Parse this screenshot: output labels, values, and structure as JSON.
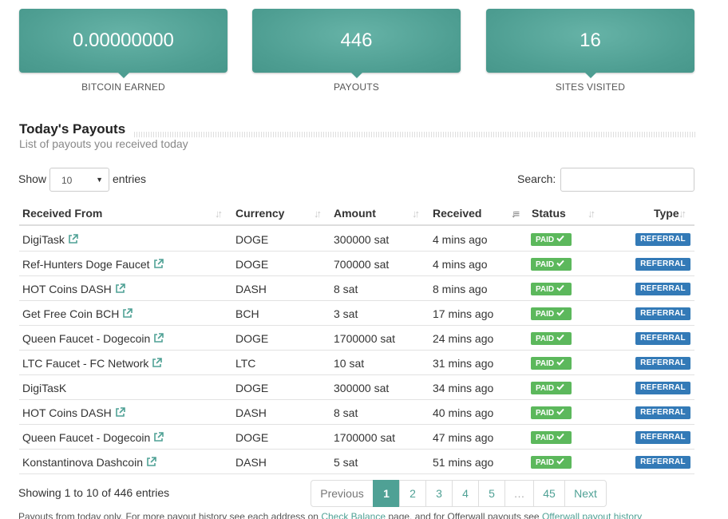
{
  "stats": [
    {
      "value": "0.00000000",
      "label": "BITCOIN EARNED"
    },
    {
      "value": "446",
      "label": "PAYOUTS"
    },
    {
      "value": "16",
      "label": "SITES VISITED"
    }
  ],
  "section": {
    "title": "Today's Payouts",
    "subtitle": "List of payouts you received today"
  },
  "controls": {
    "show_label": "Show",
    "entries_value": "10",
    "entries_label": "entries",
    "search_label": "Search:",
    "search_value": ""
  },
  "table": {
    "headers": [
      "Received From",
      "Currency",
      "Amount",
      "Received",
      "Status",
      "Type"
    ],
    "rows": [
      {
        "from": "DigiTask",
        "currency": "DOGE",
        "amount": "300000 sat",
        "received": "4 mins ago",
        "status": "PAID",
        "type": "REFERRAL"
      },
      {
        "from": "Ref-Hunters Doge Faucet",
        "currency": "DOGE",
        "amount": "700000 sat",
        "received": "4 mins ago",
        "status": "PAID",
        "type": "REFERRAL"
      },
      {
        "from": "HOT Coins DASH",
        "currency": "DASH",
        "amount": "8 sat",
        "received": "8 mins ago",
        "status": "PAID",
        "type": "REFERRAL"
      },
      {
        "from": "Get Free Coin BCH",
        "currency": "BCH",
        "amount": "3 sat",
        "received": "17 mins ago",
        "status": "PAID",
        "type": "REFERRAL"
      },
      {
        "from": "Queen Faucet - Dogecoin",
        "currency": "DOGE",
        "amount": "1700000 sat",
        "received": "24 mins ago",
        "status": "PAID",
        "type": "REFERRAL"
      },
      {
        "from": "LTC Faucet - FC Network",
        "currency": "LTC",
        "amount": "10 sat",
        "received": "31 mins ago",
        "status": "PAID",
        "type": "REFERRAL"
      },
      {
        "from": "DigiTasK",
        "currency": "DOGE",
        "amount": "300000 sat",
        "received": "34 mins ago",
        "status": "PAID",
        "type": "REFERRAL"
      },
      {
        "from": "HOT Coins DASH",
        "currency": "DASH",
        "amount": "8 sat",
        "received": "40 mins ago",
        "status": "PAID",
        "type": "REFERRAL"
      },
      {
        "from": "Queen Faucet - Dogecoin",
        "currency": "DOGE",
        "amount": "1700000 sat",
        "received": "47 mins ago",
        "status": "PAID",
        "type": "REFERRAL"
      },
      {
        "from": "Konstantinova Dashcoin",
        "currency": "DASH",
        "amount": "5 sat",
        "received": "51 mins ago",
        "status": "PAID",
        "type": "REFERRAL"
      }
    ]
  },
  "footer": {
    "info": "Showing 1 to 10 of 446 entries",
    "pagination": [
      "Previous",
      "1",
      "2",
      "3",
      "4",
      "5",
      "…",
      "45",
      "Next"
    ],
    "note_1": "Payouts from today only. For more payout history see each address on ",
    "link_1": "Check Balance",
    "note_2": " page, and for Offerwall payouts see ",
    "link_2": "Offerwall payout history"
  },
  "colors": {
    "accent": "#4fa195",
    "paid": "#5cb85c",
    "referral": "#337ab7"
  },
  "icons": {
    "external_link": "external-link-icon",
    "check": "check-icon",
    "sort": "sort-icon"
  }
}
